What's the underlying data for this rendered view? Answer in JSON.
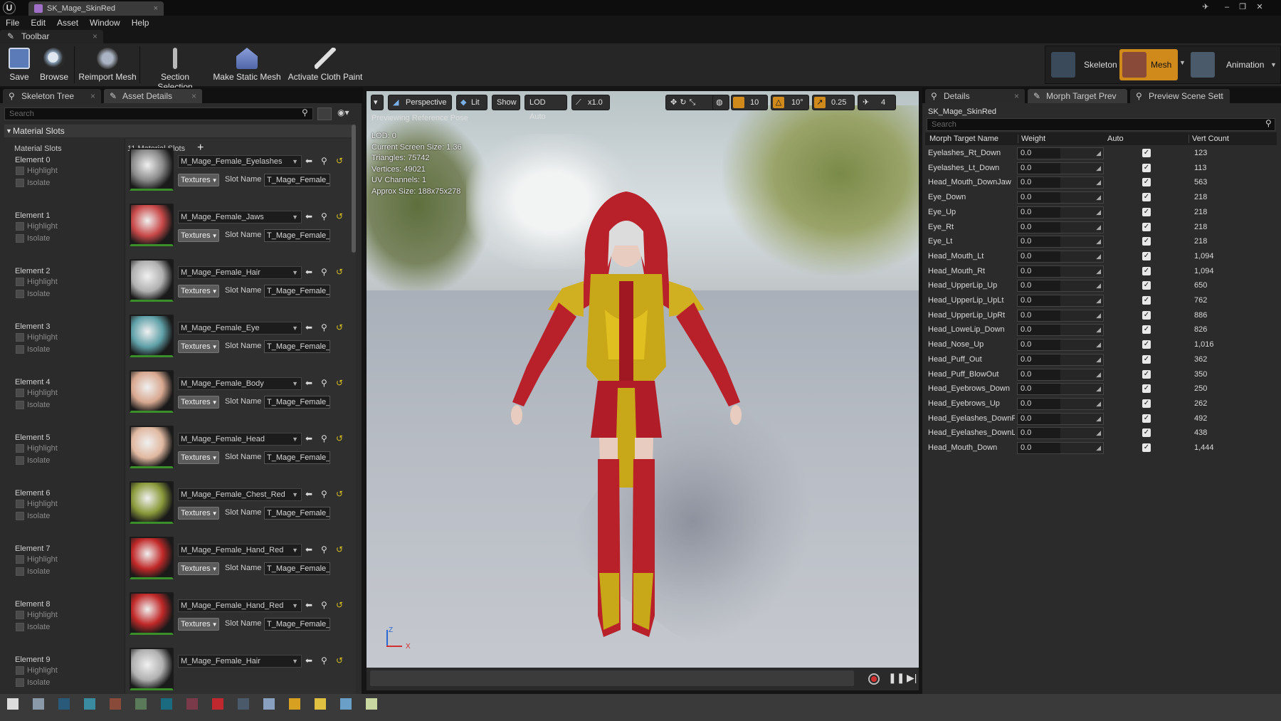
{
  "window": {
    "tab_title": "SK_Mage_SkinRed"
  },
  "menu": [
    "File",
    "Edit",
    "Asset",
    "Window",
    "Help"
  ],
  "toolbar": {
    "tab_label": "Toolbar",
    "buttons": [
      {
        "label": "Save",
        "icon": "save-icon"
      },
      {
        "label": "Browse",
        "icon": "browse-icon"
      },
      {
        "label": "Reimport Mesh",
        "icon": "reimport-icon"
      },
      {
        "label": "Section Selection",
        "icon": "section-selection-icon"
      },
      {
        "label": "Make Static Mesh",
        "icon": "static-mesh-icon"
      },
      {
        "label": "Activate Cloth Paint",
        "icon": "cloth-paint-icon"
      }
    ],
    "modes": [
      {
        "label": "Skeleton"
      },
      {
        "label": "Mesh"
      },
      {
        "label": "Animation"
      }
    ]
  },
  "left": {
    "tabs": [
      "Skeleton Tree",
      "Asset Details"
    ],
    "search_placeholder": "Search",
    "section_title": "Material Slots",
    "header_label": "Material Slots",
    "slot_count": "11 Material Slots",
    "highlight_label": "Highlight",
    "isolate_label": "Isolate",
    "textures_label": "Textures",
    "slot_name_label": "Slot Name",
    "elements": [
      {
        "label": "Element 0",
        "material": "M_Mage_Female_Eyelashes",
        "slot": "T_Mage_Female_I",
        "thumb": "#8a8a8a"
      },
      {
        "label": "Element 1",
        "material": "M_Mage_Female_Jaws",
        "slot": "T_Mage_Female_",
        "thumb": "#c84848"
      },
      {
        "label": "Element 2",
        "material": "M_Mage_Female_Hair",
        "slot": "T_Mage_Female_I",
        "thumb": "#b0b0b0"
      },
      {
        "label": "Element 3",
        "material": "M_Mage_Female_Eye",
        "slot": "T_Mage_Female_I",
        "thumb": "#5fa0a8"
      },
      {
        "label": "Element 4",
        "material": "M_Mage_Female_Body",
        "slot": "T_Mage_Female_I",
        "thumb": "#d8a890"
      },
      {
        "label": "Element 5",
        "material": "M_Mage_Female_Head",
        "slot": "T_Mage_Female_I",
        "thumb": "#e0b8a0"
      },
      {
        "label": "Element 6",
        "material": "M_Mage_Female_Chest_Red",
        "slot": "T_Mage_Female_I",
        "thumb": "#8a9a3a"
      },
      {
        "label": "Element 7",
        "material": "M_Mage_Female_Hand_Red",
        "slot": "T_Mage_Female_I",
        "thumb": "#c02828"
      },
      {
        "label": "Element 8",
        "material": "M_Mage_Female_Hand_Red",
        "slot": "T_Mage_Female_I",
        "thumb": "#c02828"
      },
      {
        "label": "Element 9",
        "material": "M_Mage_Female_Hair",
        "slot": "T_Mage_Female_I",
        "thumb": "#b0b0b0"
      }
    ]
  },
  "viewport": {
    "buttons": [
      "Perspective",
      "Lit",
      "Show",
      "LOD Auto",
      "x1.0"
    ],
    "right_values": [
      "10",
      "10°",
      "0.25",
      "4"
    ],
    "preview_label": "Previewing Reference Pose",
    "stats": [
      "LOD: 0",
      "Current Screen Size: 1.36",
      "Triangles: 75742",
      "Vertices: 49021",
      "UV Channels: 1",
      "Approx Size: 188x75x278"
    ],
    "axis": {
      "z": "Z",
      "x": "X"
    }
  },
  "right": {
    "tabs": [
      "Details",
      "Morph Target Prev",
      "Preview Scene Sett"
    ],
    "asset_name": "SK_Mage_SkinRed",
    "search_placeholder": "Search",
    "columns": [
      "Morph Target Name",
      "Weight",
      "Auto",
      "Vert Count"
    ],
    "morphs": [
      {
        "name": "Eyelashes_Rt_Down",
        "weight": "0.0",
        "verts": "123"
      },
      {
        "name": "Eyelashes_Lt_Down",
        "weight": "0.0",
        "verts": "113"
      },
      {
        "name": "Head_Mouth_DownJaw",
        "weight": "0.0",
        "verts": "563"
      },
      {
        "name": "Eye_Down",
        "weight": "0.0",
        "verts": "218"
      },
      {
        "name": "Eye_Up",
        "weight": "0.0",
        "verts": "218"
      },
      {
        "name": "Eye_Rt",
        "weight": "0.0",
        "verts": "218"
      },
      {
        "name": "Eye_Lt",
        "weight": "0.0",
        "verts": "218"
      },
      {
        "name": "Head_Mouth_Lt",
        "weight": "0.0",
        "verts": "1,094"
      },
      {
        "name": "Head_Mouth_Rt",
        "weight": "0.0",
        "verts": "1,094"
      },
      {
        "name": "Head_UpperLip_Up",
        "weight": "0.0",
        "verts": "650"
      },
      {
        "name": "Head_UpperLip_UpLt",
        "weight": "0.0",
        "verts": "762"
      },
      {
        "name": "Head_UpperLip_UpRt",
        "weight": "0.0",
        "verts": "886"
      },
      {
        "name": "Head_LoweLip_Down",
        "weight": "0.0",
        "verts": "826"
      },
      {
        "name": "Head_Nose_Up",
        "weight": "0.0",
        "verts": "1,016"
      },
      {
        "name": "Head_Puff_Out",
        "weight": "0.0",
        "verts": "362"
      },
      {
        "name": "Head_Puff_BlowOut",
        "weight": "0.0",
        "verts": "350"
      },
      {
        "name": "Head_Eyebrows_Down",
        "weight": "0.0",
        "verts": "250"
      },
      {
        "name": "Head_Eyebrows_Up",
        "weight": "0.0",
        "verts": "262"
      },
      {
        "name": "Head_Eyelashes_DownR",
        "weight": "0.0",
        "verts": "492"
      },
      {
        "name": "Head_Eyelashes_DownL",
        "weight": "0.0",
        "verts": "438"
      },
      {
        "name": "Head_Mouth_Down",
        "weight": "0.0",
        "verts": "1,444"
      }
    ]
  },
  "colors": {
    "accent_orange": "#d08a1c",
    "slot_green": "#3b8f2a",
    "panel": "#2b2b2b"
  }
}
